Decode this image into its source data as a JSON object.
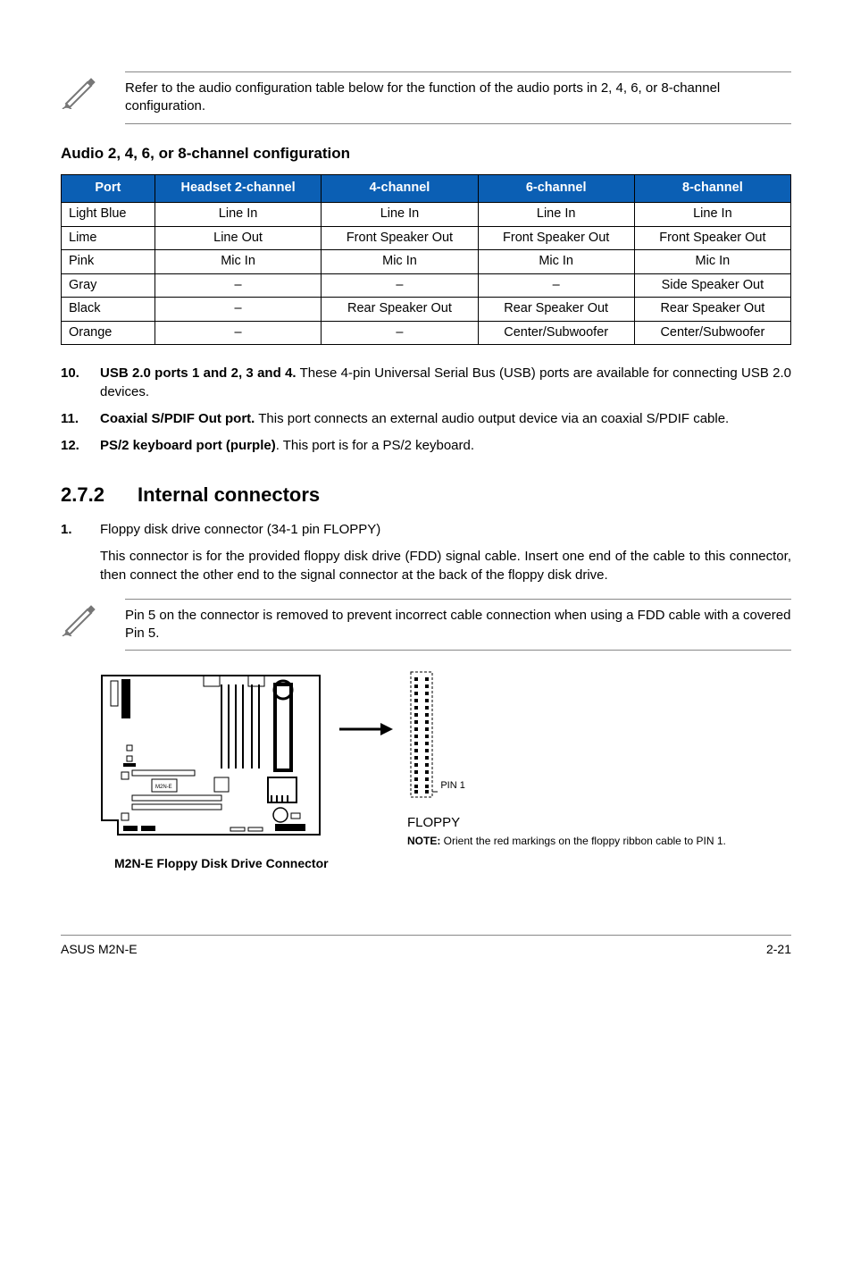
{
  "note1": "Refer to the audio configuration table below for the function of the audio ports in 2, 4, 6, or 8-channel configuration.",
  "audio_heading": "Audio 2, 4, 6, or 8-channel configuration",
  "table": {
    "headers": {
      "port": "Port",
      "h2": "Headset 2-channel",
      "c4": "4-channel",
      "c6": "6-channel",
      "c8": "8-channel"
    },
    "rows": [
      {
        "port": "Light Blue",
        "h2": "Line In",
        "c4": "Line In",
        "c6": "Line In",
        "c8": "Line In"
      },
      {
        "port": "Lime",
        "h2": "Line Out",
        "c4": "Front Speaker Out",
        "c6": "Front Speaker Out",
        "c8": "Front Speaker Out"
      },
      {
        "port": "Pink",
        "h2": "Mic In",
        "c4": "Mic In",
        "c6": "Mic In",
        "c8": "Mic In"
      },
      {
        "port": "Gray",
        "h2": "–",
        "c4": "–",
        "c6": "–",
        "c8": "Side Speaker Out"
      },
      {
        "port": "Black",
        "h2": "–",
        "c4": "Rear Speaker Out",
        "c6": "Rear Speaker Out",
        "c8": "Rear Speaker Out"
      },
      {
        "port": "Orange",
        "h2": "–",
        "c4": "–",
        "c6": "Center/Subwoofer",
        "c8": "Center/Subwoofer"
      }
    ]
  },
  "items": {
    "i10": {
      "num": "10.",
      "bold": "USB 2.0 ports 1 and 2, 3 and 4.",
      "rest": " These 4-pin Universal Serial Bus (USB) ports are available for connecting USB 2.0 devices."
    },
    "i11": {
      "num": "11.",
      "bold": "Coaxial S/PDIF Out port.",
      "rest": " This port connects an external audio output device via an coaxial S/PDIF cable."
    },
    "i12": {
      "num": "12.",
      "bold": "PS/2 keyboard port (purple)",
      "rest": ". This port is for a PS/2 keyboard."
    }
  },
  "section": {
    "num": "2.7.2",
    "title": "Internal connectors"
  },
  "floppy": {
    "num": "1.",
    "bold": "Floppy disk drive connector (34-1 pin FLOPPY)",
    "desc": "This connector is for the provided floppy disk drive (FDD) signal cable. Insert one end of the cable to this connector, then connect the other end to the signal connector at the back of the floppy disk drive."
  },
  "note2": "Pin 5 on the connector is removed to prevent incorrect cable connection when using a FDD cable with a covered Pin 5.",
  "diagram": {
    "pin1": "PIN 1",
    "floppy_label": "FLOPPY",
    "note_bold": "NOTE:",
    "note_rest": " Orient the red markings on the floppy ribbon cable to PIN 1.",
    "caption": "M2N-E Floppy Disk Drive Connector",
    "chip_label": "M2N-E"
  },
  "footer": {
    "left": "ASUS M2N-E",
    "right": "2-21"
  }
}
